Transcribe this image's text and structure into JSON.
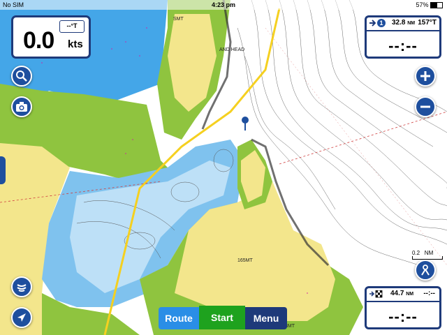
{
  "status_bar": {
    "carrier": "No SIM",
    "time": "4:23 pm",
    "battery": "57%"
  },
  "speed": {
    "value": "0.0",
    "unit": "kts",
    "heading": "--°T"
  },
  "waypoint_top": {
    "number": "1",
    "distance": "32.8",
    "distance_unit": "NM",
    "bearing": "157°T",
    "eta": "--:--"
  },
  "waypoint_bottom": {
    "distance": "44.7",
    "distance_unit": "NM",
    "eta": "--:--",
    "eta_small": "--:--"
  },
  "bottom_bar": {
    "route": "Route",
    "start": "Start",
    "menu": "Menu"
  },
  "scale": {
    "value": "0.2",
    "unit": "NM"
  },
  "map_labels": {
    "head": "AND HEAD",
    "height_1": "165MT",
    "height_2": "SMT",
    "height_3": "8MT"
  },
  "icons": [
    "search-icon",
    "camera-icon",
    "zoom-in-icon",
    "zoom-out-icon",
    "sonar-icon",
    "locate-arrow-icon",
    "pin-icon",
    "man-overboard-icon",
    "checkered-flag-icon"
  ],
  "colors": {
    "land": "#f3e68c",
    "green": "#8fc43f",
    "deep_blue": "#44a6e8",
    "light_blue": "#bde0f7",
    "panel_border": "#1e3a7a",
    "start_green": "#1ea21e",
    "route_blue": "#2a8ee6",
    "menu_navy": "#1e3a7a"
  }
}
